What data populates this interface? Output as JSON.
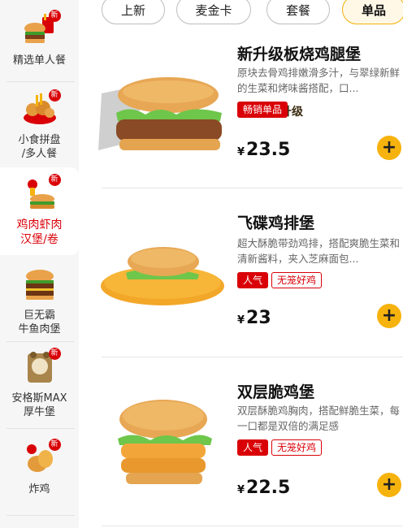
{
  "sidebar": {
    "items": [
      {
        "label": "精选单人餐",
        "badge": "新",
        "active": false
      },
      {
        "label": "小食拼盘\n/多人餐",
        "badge": "新",
        "active": false
      },
      {
        "label": "鸡肉虾肉\n汉堡/卷",
        "badge": "新",
        "active": true
      },
      {
        "label": "巨无霸\n牛鱼肉堡",
        "badge": "",
        "active": false
      },
      {
        "label": "安格斯MAX\n厚牛堡",
        "badge": "新",
        "active": false
      },
      {
        "label": "炸鸡",
        "badge": "新",
        "active": false
      }
    ]
  },
  "tabs": [
    {
      "label": "上新",
      "active": false
    },
    {
      "label": "麦金卡",
      "active": false
    },
    {
      "label": "套餐",
      "active": false
    },
    {
      "label": "单品",
      "active": true
    }
  ],
  "products": [
    {
      "name": "新升级板烧鸡腿堡",
      "desc": "原块去骨鸡排嫩滑多汁，与翠绿新鲜的生菜和烤味酱搭配，口...",
      "tags": [
        "畅销单品"
      ],
      "currency": "¥",
      "price": "23.5",
      "image_label": "新升级"
    },
    {
      "name": "飞碟鸡排堡",
      "desc": "超大酥脆带劲鸡排，搭配爽脆生菜和清新酱料，夹入芝麻面包...",
      "tags": [
        "人气",
        "无笼好鸡"
      ],
      "currency": "¥",
      "price": "23"
    },
    {
      "name": "双层脆鸡堡",
      "desc": "双层酥脆鸡胸肉，搭配鲜脆生菜，每一口都是双倍的满足感",
      "tags": [
        "人气",
        "无笼好鸡"
      ],
      "currency": "¥",
      "price": "22.5"
    }
  ],
  "colors": {
    "accent": "#d90007",
    "brand_yellow": "#f6b30d"
  },
  "icons": {
    "add": "plus-icon"
  }
}
